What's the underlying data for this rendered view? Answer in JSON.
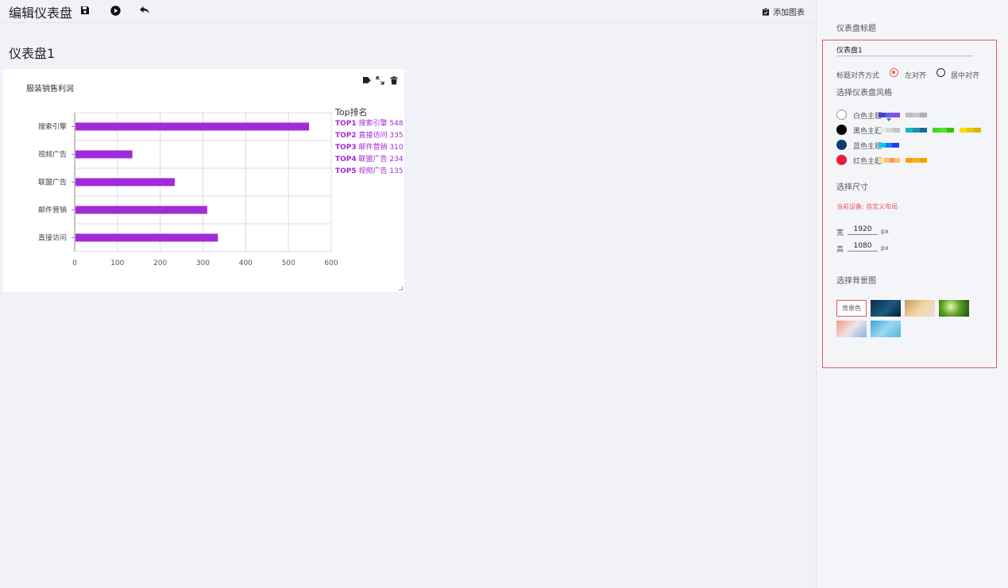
{
  "toolbar": {
    "title": "编辑仪表盘",
    "icons": [
      "save-icon",
      "play-icon",
      "undo-icon"
    ],
    "add_chart_label": "添加图表"
  },
  "dashboard": {
    "title": "仪表盘1"
  },
  "chart_card": {
    "tools": [
      "edit-icon",
      "expand-icon",
      "delete-icon"
    ]
  },
  "chart_data": {
    "type": "bar",
    "orientation": "horizontal",
    "title": "服装销售利润",
    "categories": [
      "直接访问",
      "邮件营销",
      "联盟广告",
      "视频广告",
      "搜索引擎"
    ],
    "values": [
      335,
      310,
      234,
      135,
      548
    ],
    "xlim": [
      0,
      600
    ],
    "xticks": [
      "0",
      "100",
      "200",
      "300",
      "400",
      "500",
      "600"
    ],
    "bar_color": "#a12bd8",
    "grid": true,
    "legend": {
      "position": "right",
      "title": "Top排名",
      "items": [
        {
          "rank": "TOP1",
          "name": "搜索引擎",
          "value": "548"
        },
        {
          "rank": "TOP2",
          "name": "直接访问",
          "value": "335"
        },
        {
          "rank": "TOP3",
          "name": "邮件营销",
          "value": "310"
        },
        {
          "rank": "TOP4",
          "name": "联盟广告",
          "value": "234"
        },
        {
          "rank": "TOP5",
          "name": "视频广告",
          "value": "135"
        }
      ]
    }
  },
  "sidebar": {
    "title_section": "仪表盘标题",
    "title_value": "仪表盘1",
    "align_label": "标题对齐方式",
    "align_options": [
      {
        "label": "左对齐",
        "selected": true
      },
      {
        "label": "居中对齐",
        "selected": false
      }
    ],
    "style_label": "选择仪表盘风格",
    "themes": [
      {
        "label": "白色主题",
        "dot_color": "#ffffff",
        "swatches": [
          [
            "#4c3fd8",
            "#6a5de6",
            "#8a4fe0"
          ],
          [
            "#bdbdbd",
            "#c8c8c8",
            "#b0b0b0"
          ]
        ]
      },
      {
        "label": "黑色主题",
        "dot_color": "#000000",
        "swatches": [
          [
            "#e8e8e8",
            "#d6d6d6",
            "#c4c4c4"
          ],
          [
            "#1fb5c9",
            "#1c8fb0",
            "#1a6a93"
          ],
          [
            "#3ddc1a",
            "#58e02b",
            "#2bc70f"
          ],
          [
            "#f0e000",
            "#e8c900",
            "#d9b300"
          ]
        ]
      },
      {
        "label": "蓝色主题",
        "dot_color": "#0c3b78",
        "swatches": [
          [
            "#00c8f0",
            "#1a7af0",
            "#1c3ef0"
          ]
        ]
      },
      {
        "label": "红色主题",
        "dot_color": "#e81e3c",
        "swatches": [
          [
            "#fbe3a6",
            "#f7c46a",
            "#f29a5e",
            "#f7c46a"
          ],
          [
            "#f6a000",
            "#f7b41a",
            "#f5a300"
          ]
        ]
      }
    ],
    "size_label": "选择尺寸",
    "current_device": "当前设备: 自定义布局",
    "width_label": "宽",
    "width_value": "1920",
    "height_label": "高",
    "height_value": "1080",
    "unit": "px",
    "bg_label": "选择背景图",
    "bg_color_button": "背景色",
    "bg_images": [
      "dark-blue-night",
      "warm-haze",
      "green-foliage",
      "pink-sunset",
      "light-blue-sky"
    ]
  }
}
